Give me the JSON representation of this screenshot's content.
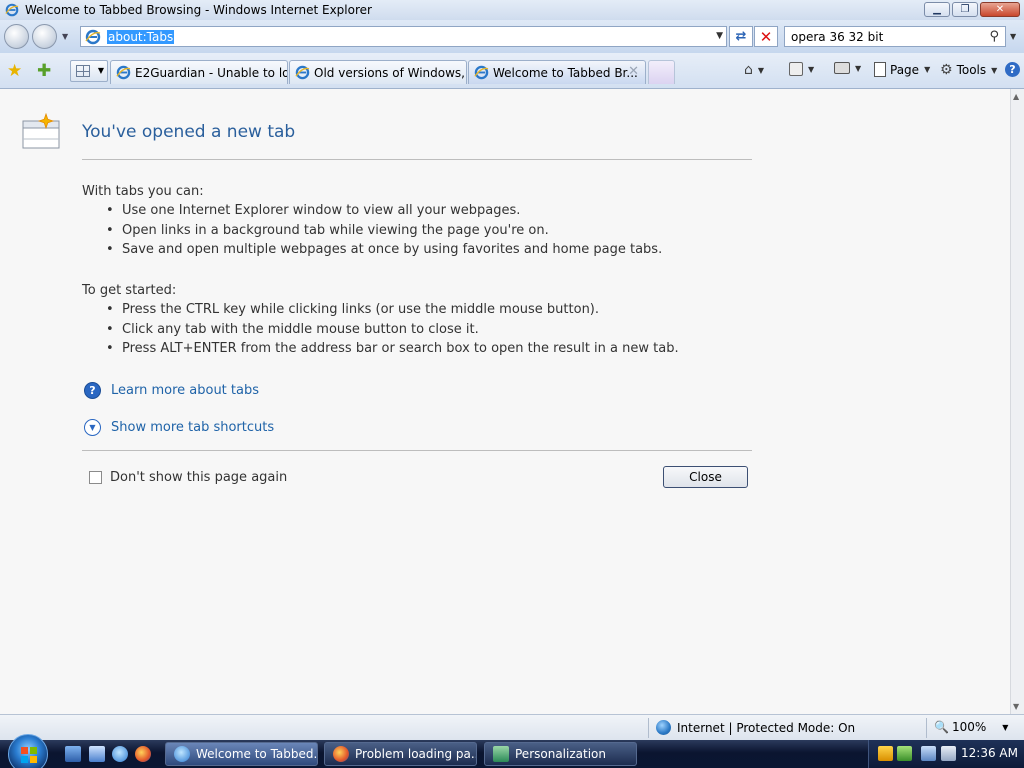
{
  "window": {
    "title": "Welcome to Tabbed Browsing - Windows Internet Explorer",
    "controls": {
      "minimize": "▁",
      "maximize": "❐",
      "close": "✕"
    }
  },
  "navigation": {
    "address": "about:Tabs",
    "search_value": "opera 36 32 bit"
  },
  "tabs": [
    {
      "label": "E2Guardian - Unable to loa...",
      "active": false
    },
    {
      "label": "Old versions of Windows, ...",
      "active": false
    },
    {
      "label": "Welcome to Tabbed Br...",
      "active": true
    }
  ],
  "commandbar": {
    "page_label": "Page",
    "tools_label": "Tools"
  },
  "content": {
    "title": "You've opened a new tab",
    "tabs_heading": "With tabs you can:",
    "tabs_bullets": [
      "Use one Internet Explorer window to view all your webpages.",
      "Open links in a background tab while viewing the page you're on.",
      "Save and open multiple webpages at once by using favorites and home page tabs."
    ],
    "started_heading": "To get started:",
    "started_bullets": [
      "Press the CTRL key while clicking links (or use the middle mouse button).",
      "Click any tab with the middle mouse button to close it.",
      "Press ALT+ENTER from the address bar or search box to open the result in a new tab."
    ],
    "learn_more_link": "Learn more about tabs",
    "shortcuts_link": "Show more tab shortcuts",
    "dont_show_label": "Don't show this page again",
    "close_button": "Close"
  },
  "statusbar": {
    "zone": "Internet | Protected Mode: On",
    "zoom": "100%"
  },
  "taskbar": {
    "tasks": [
      {
        "label": "Welcome to Tabbed..."
      },
      {
        "label": "Problem loading pa..."
      },
      {
        "label": "Personalization"
      }
    ],
    "clock": "12:36 AM"
  },
  "icons": {
    "favorites": "favorites-star-icon",
    "add_favorites": "add-favorites-icon",
    "home": "home-icon",
    "feeds": "feeds-icon",
    "print": "print-icon",
    "page": "page-icon",
    "tools": "gear-icon",
    "help": "help-icon"
  },
  "colors": {
    "accent_link": "#1f63a8",
    "title_blue": "#2a5f9c",
    "selection": "#3399ff"
  }
}
